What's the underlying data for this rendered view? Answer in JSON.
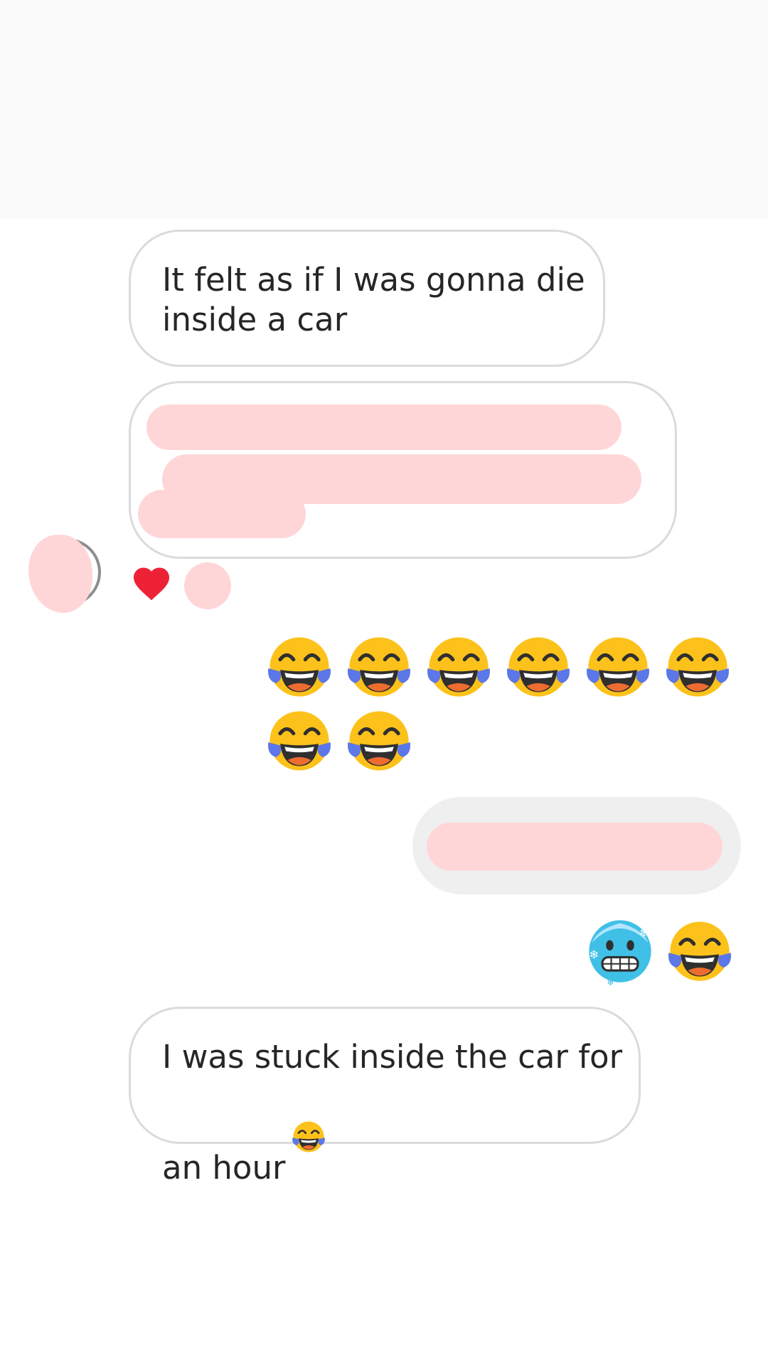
{
  "messages": {
    "received_1": "It felt as if I was gonna die\ninside a car",
    "received_3_prefix": "I was stuck inside the car for\nan hour",
    "received_3_emoji": "face-with-tears-of-joy"
  },
  "reaction": {
    "icon": "heart-icon",
    "color": "#ed2236"
  },
  "emoji_message_1": {
    "emoji": "face-with-tears-of-joy",
    "count": 8
  },
  "emoji_message_2": {
    "emojis": [
      "cold-face",
      "face-with-tears-of-joy"
    ]
  },
  "colors": {
    "redaction": "#ffd6d8",
    "bubble_border": "#dbdbdb",
    "sent_bubble": "#efefef",
    "text": "#262626"
  }
}
